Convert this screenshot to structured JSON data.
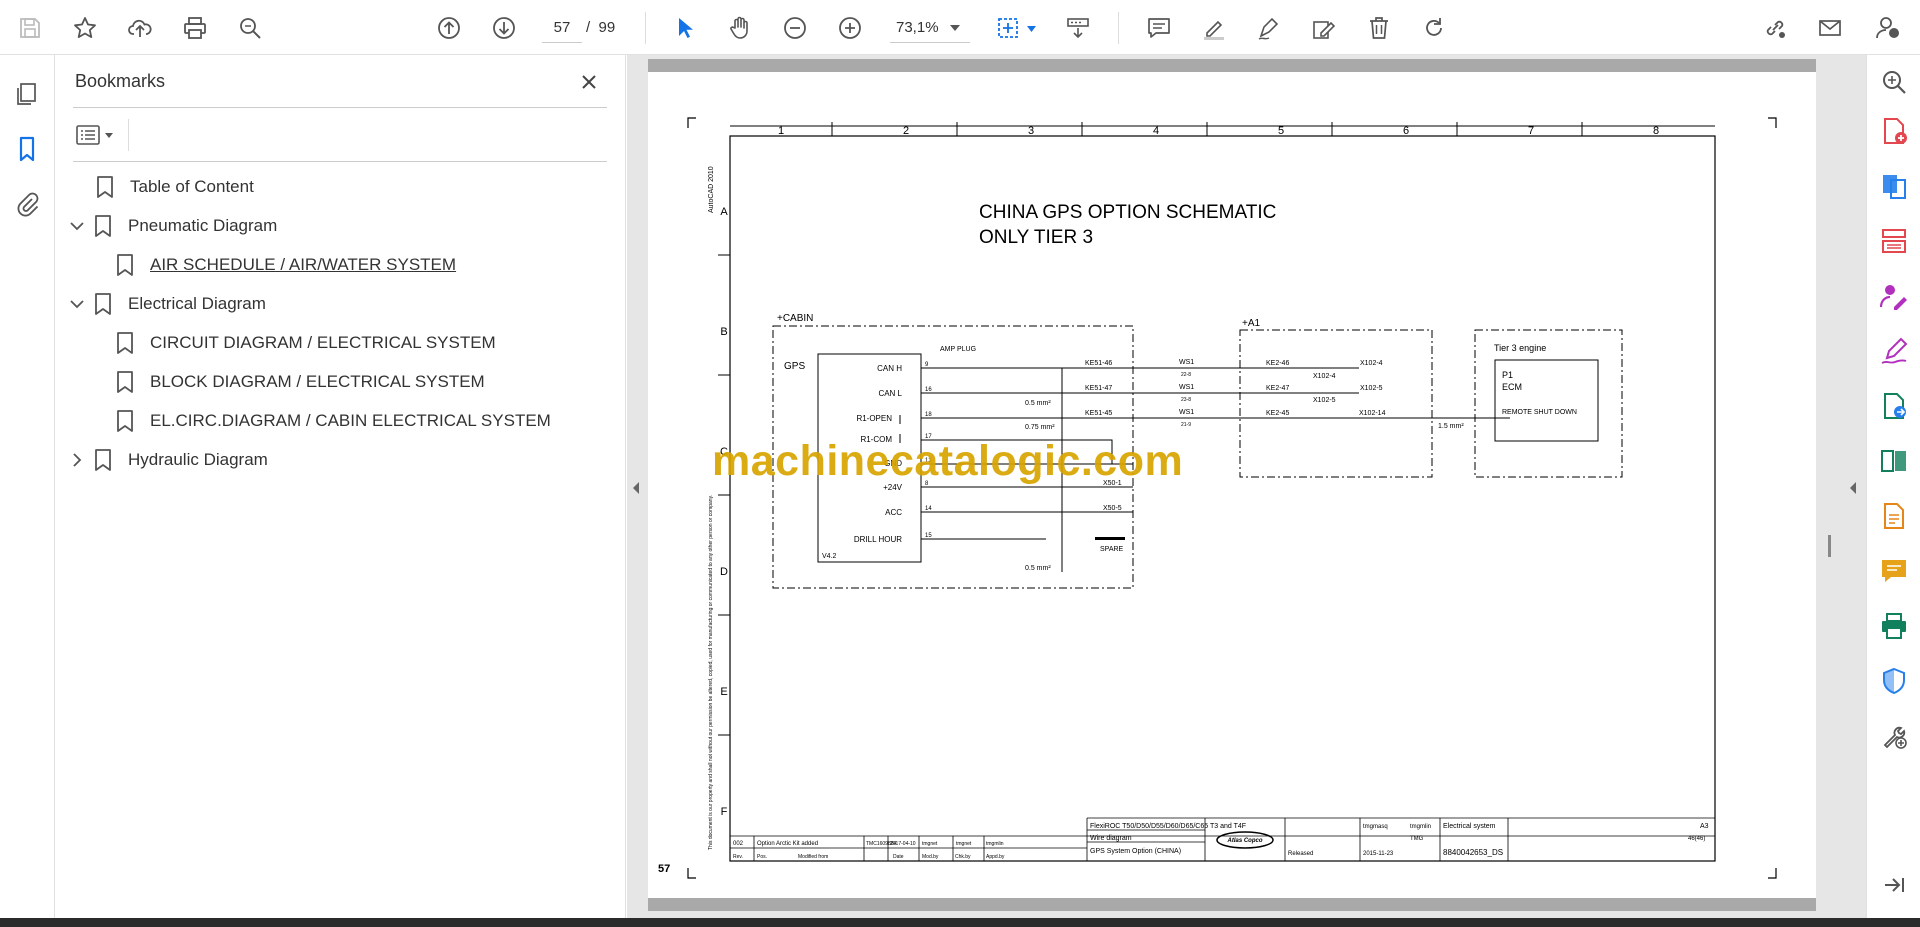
{
  "toolbar": {
    "current_page": "57",
    "page_separator": "/",
    "total_pages": "99",
    "zoom": "73,1%"
  },
  "bookmarks": {
    "title": "Bookmarks",
    "items": [
      {
        "label": "Table of Content",
        "level": 0,
        "expandable": false
      },
      {
        "label": "Pneumatic Diagram",
        "level": 0,
        "expandable": true,
        "expanded": true
      },
      {
        "label": "AIR SCHEDULE / AIR/WATER SYSTEM",
        "level": 1,
        "selected": true
      },
      {
        "label": "Electrical Diagram",
        "level": 0,
        "expandable": true,
        "expanded": true
      },
      {
        "label": "CIRCUIT DIAGRAM / ELECTRICAL SYSTEM",
        "level": 1
      },
      {
        "label": "BLOCK DIAGRAM / ELECTRICAL SYSTEM",
        "level": 1
      },
      {
        "label": "EL.CIRC.DIAGRAM / CABIN ELECTRICAL SYSTEM",
        "level": 1
      },
      {
        "label": "Hydraulic Diagram",
        "level": 0,
        "expandable": true,
        "expanded": false
      }
    ]
  },
  "document": {
    "watermark": "machinecatalogic.com",
    "page_label": "57",
    "side_text": "AutoCAD 2010",
    "column_numbers": [
      "1",
      "2",
      "3",
      "4",
      "5",
      "6",
      "7",
      "8"
    ],
    "row_letters": [
      "A",
      "B",
      "C",
      "D",
      "E",
      "F"
    ],
    "title_line1": "CHINA GPS OPTION SCHEMATIC",
    "title_line2": "ONLY TIER 3",
    "cabin_label": "+CABIN",
    "a1_label": "+A1",
    "gps_label": "GPS",
    "amp_plug": "AMP PLUG",
    "version": "V4.2",
    "gps_pins": [
      "CAN H",
      "CAN L",
      "R1-OPEN",
      "R1-COM",
      "GND",
      "+24V",
      "ACC",
      "DRILL HOUR"
    ],
    "pin_numbers": [
      "9",
      "16",
      "18",
      "17",
      "13",
      "8",
      "14",
      "15"
    ],
    "wire_labels": [
      "KE51-46",
      "KE51-47",
      "KE51-45",
      "X50-4",
      "X50-1",
      "X50-5"
    ],
    "wire_sizes": [
      "0.5 mm²",
      "0.75 mm²",
      "0.5 mm²",
      "1.5 mm²"
    ],
    "ws_labels": [
      "WS1",
      "WS1",
      "WS1"
    ],
    "ws_sub": [
      "22-8",
      "23-8",
      "21-9"
    ],
    "ke2_labels": [
      "KE2-46",
      "KE2-47",
      "KE2-45"
    ],
    "x102_labels": [
      "X102-4",
      "X102-5",
      "X102-14",
      "X102-4",
      "X102-5"
    ],
    "spare": "SPARE",
    "engine_label": "Tier 3 engine",
    "ecm_lines": [
      "P1",
      "ECM",
      "REMOTE SHUT DOWN"
    ],
    "tb_rev": "002",
    "tb_change": "Option Arctic Kit added",
    "tb_ref": "TMC1609884",
    "tb_date": "2017-04-10",
    "tb_mod": "tmgnet",
    "tb_chk": "tmgnet",
    "tb_app": "tmgmlin",
    "tb_hdr": [
      "Rev.",
      "Pos.",
      "Modified from",
      "Date",
      "Mod.by",
      "Chk.by",
      "Appd.by"
    ],
    "tb_product": "FlexiROC T50/D50/D55/D60/D65/C65 T3 and T4F",
    "tb_type": "Wire diagram",
    "tb_name": "GPS System Option (CHINA)",
    "tb_drawn": "tmgmasq",
    "tb_approver": "tmgmlin",
    "tb_status": "Released",
    "tb_owner": "TMG",
    "tb_issue": "2015-11-23",
    "tb_category": "Electrical system",
    "tb_format": "A3",
    "tb_sheet": "46(46)",
    "tb_docno": "8840042653_DS",
    "tb_logo": "Atlas Copco",
    "disclaimer": "This document is our property and shall not without our permission be altered, copied, used for manufacturing or communicated to any other person or company."
  }
}
